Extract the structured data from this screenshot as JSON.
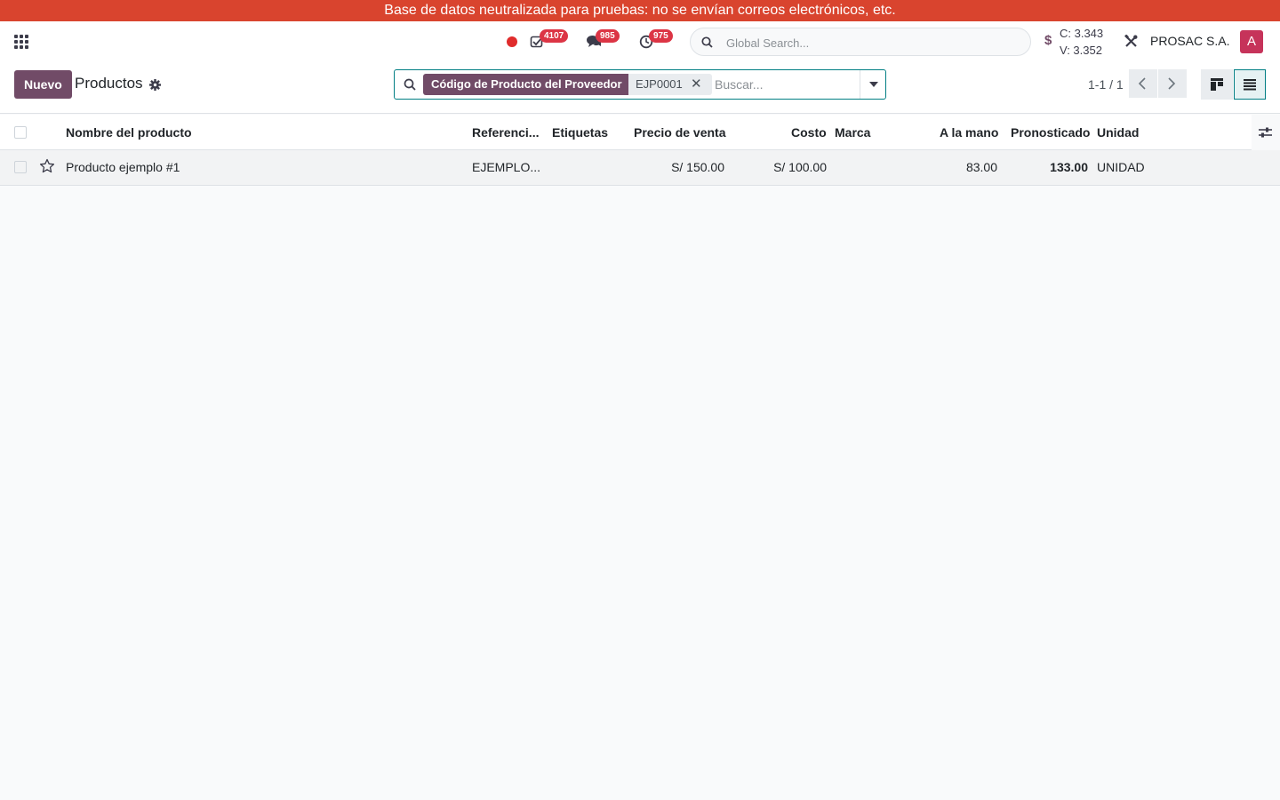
{
  "banner": {
    "text": "Base de datos neutralizada para pruebas: no se envían correos electrónicos, etc."
  },
  "navbar": {
    "activities_count": "4107",
    "messages_count": "985",
    "timesheet_count": "975",
    "global_search_placeholder": "Global Search...",
    "currency_symbol": "$",
    "rate_buy": "C: 3.343",
    "rate_sell": "V: 3.352",
    "company": "PROSAC S.A.",
    "avatar_initial": "A"
  },
  "control": {
    "new_label": "Nuevo",
    "title": "Productos",
    "facet_label": "Código de Producto del Proveedor",
    "facet_value": "EJP0001",
    "search_placeholder": "Buscar...",
    "pager": "1-1 / 1"
  },
  "table": {
    "headers": [
      "Nombre del producto",
      "Referenci...",
      "Etiquetas",
      "Precio de venta",
      "Costo",
      "Marca",
      "A la mano",
      "Pronosticado",
      "Unidad"
    ],
    "rows": [
      {
        "name": "Producto ejemplo #1",
        "reference": "EJEMPLO...",
        "tags": "",
        "price": "S/ 150.00",
        "cost": "S/ 100.00",
        "brand": "",
        "on_hand": "83.00",
        "forecast": "133.00",
        "unit": "UNIDAD"
      }
    ]
  },
  "colors": {
    "brand": "#714b67",
    "banner": "#d9442e",
    "accent": "#017e84",
    "badge": "#dc3545"
  },
  "icons": [
    "apps-icon",
    "record-icon",
    "activity-icon",
    "messages-icon",
    "clock-icon",
    "search-icon",
    "dollar-icon",
    "tools-icon",
    "gear-icon",
    "caret-down-icon",
    "chevron-left-icon",
    "chevron-right-icon",
    "kanban-icon",
    "list-icon",
    "column-options-icon",
    "star-icon"
  ]
}
